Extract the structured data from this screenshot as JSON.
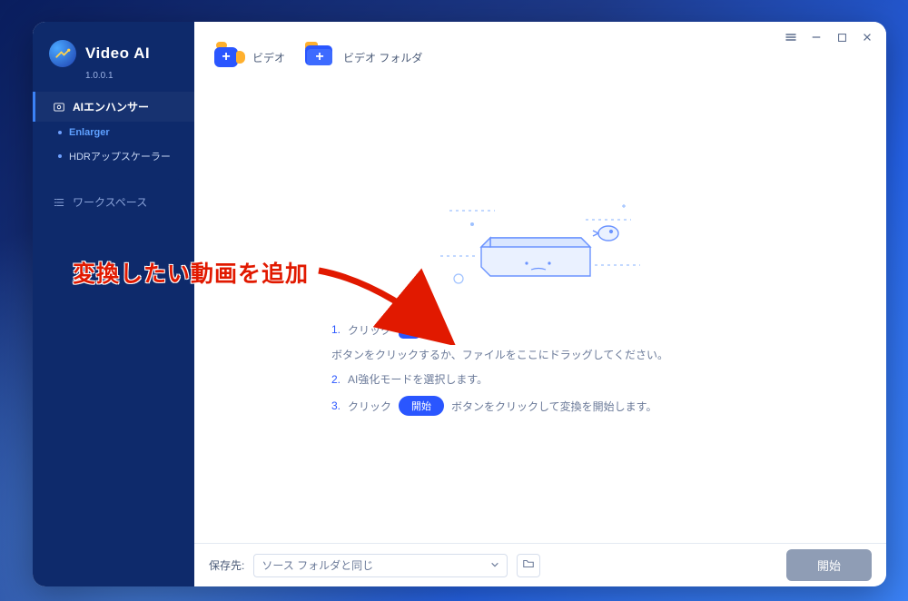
{
  "brand": {
    "title": "Video AI",
    "version": "1.0.0.1"
  },
  "sidebar": {
    "section_ai": "AIエンハンサー",
    "items": [
      {
        "label": "Enlarger"
      },
      {
        "label": "HDRアップスケーラー"
      }
    ],
    "workspace": "ワークスペース"
  },
  "toolbar": {
    "video_label": "ビデオ",
    "folder_label": "ビデオ フォルダ"
  },
  "steps": {
    "s1_prefix": "1.",
    "s1_click": "クリック",
    "s1_suffix": "ボタンをクリックするか、ファイルをここにドラッグしてください。",
    "s2_prefix": "2.",
    "s2_text": "AI強化モードを選択します。",
    "s3_prefix": "3.",
    "s3_click": "クリック",
    "s3_pill": "開始",
    "s3_suffix": "ボタンをクリックして変換を開始します。"
  },
  "footer": {
    "save_label": "保存先:",
    "save_value": "ソース フォルダと同じ",
    "start_label": "開始"
  },
  "annotation": {
    "text": "変換したい動画を追加"
  }
}
